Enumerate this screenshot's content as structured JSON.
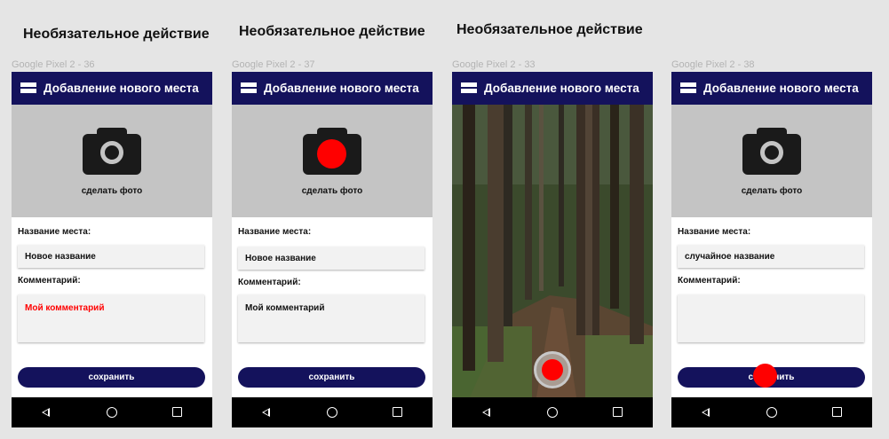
{
  "section_title": "Необязательное действие",
  "colors": {
    "appbar": "#14125c",
    "accent_red": "#ff0000",
    "photo_placeholder": "#c4c4c4",
    "canvas": "#e5e5e5"
  },
  "screens": [
    {
      "frame_label": "Google Pixel 2 - 36",
      "app_title": "Добавление нового места",
      "photo_caption": "сделать фото",
      "place_label": "Название места:",
      "place_value": "Новое название",
      "comment_label": "Комментарий:",
      "comment_value": "Мой комментарий",
      "save_label": "сохранить"
    },
    {
      "frame_label": "Google Pixel 2 - 37",
      "app_title": "Добавление нового места",
      "photo_caption": "сделать фото",
      "place_label": "Название места:",
      "place_value": "Новое название",
      "comment_label": "Комментарий:",
      "comment_value": "Мой комментарий",
      "save_label": "сохранить"
    },
    {
      "frame_label": "Google Pixel 2 - 33",
      "app_title": "Добавление нового места"
    },
    {
      "frame_label": "Google Pixel 2 - 38",
      "app_title": "Добавление нового места",
      "photo_caption": "сделать фото",
      "place_label": "Название места:",
      "place_value": "случайное название",
      "comment_label": "Комментарий:",
      "comment_value": "",
      "save_label": "сохранить"
    }
  ],
  "nav_icons": [
    "back-icon",
    "home-icon",
    "recent-apps-icon"
  ]
}
